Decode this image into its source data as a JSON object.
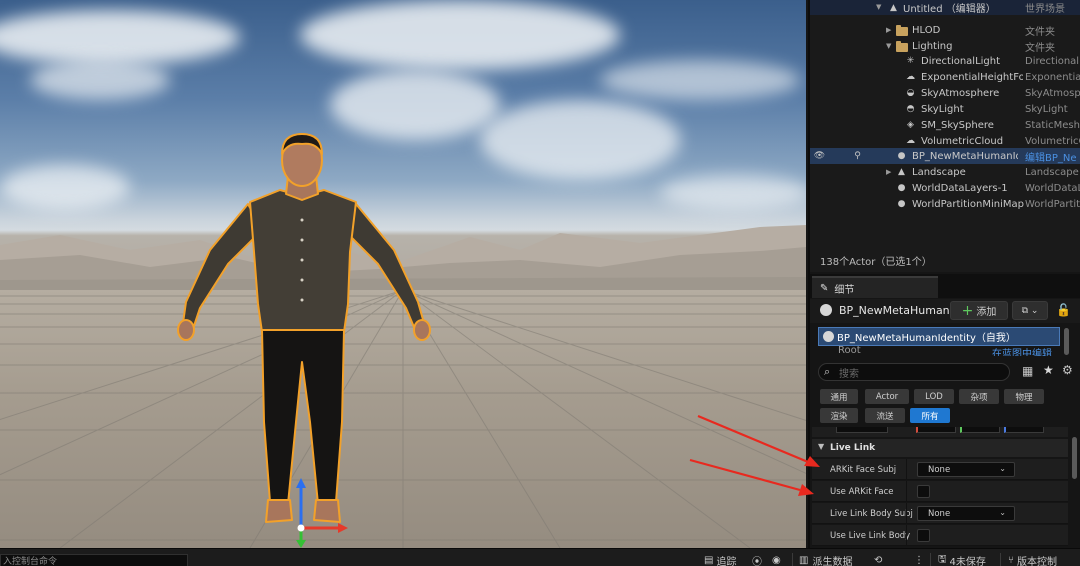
{
  "outliner": {
    "rows": [
      {
        "name": "Untitled （编辑器）",
        "type": "世界场景",
        "icon": "level-icon"
      },
      {
        "name": "HLOD",
        "type": "文件夹",
        "icon": "folder-icon"
      },
      {
        "name": "Lighting",
        "type": "文件夹",
        "icon": "folder-open-icon"
      },
      {
        "name": "DirectionalLight",
        "type": "DirectionalL",
        "icon": "directional-light-icon"
      },
      {
        "name": "ExponentialHeightFo",
        "type": "Exponential",
        "icon": "height-fog-icon"
      },
      {
        "name": "SkyAtmosphere",
        "type": "SkyAtmosp",
        "icon": "sky-atmosphere-icon"
      },
      {
        "name": "SkyLight",
        "type": "SkyLight",
        "icon": "sky-light-icon"
      },
      {
        "name": "SM_SkySphere",
        "type": "StaticMesh.",
        "icon": "static-mesh-icon"
      },
      {
        "name": "VolumetricCloud",
        "type": "VolumetricC",
        "icon": "cloud-icon"
      },
      {
        "name": "BP_NewMetaHumanId",
        "type": "编辑BP_Ne",
        "icon": "blueprint-icon"
      },
      {
        "name": "Landscape",
        "type": "Landscape",
        "icon": "landscape-icon"
      },
      {
        "name": "WorldDataLayers-1",
        "type": "WorldDataL",
        "icon": "actor-icon"
      },
      {
        "name": "WorldPartitionMiniMap",
        "type": "WorldPartit",
        "icon": "actor-icon"
      }
    ],
    "actor_count": "138个Actor（已选1个）"
  },
  "details": {
    "tab_label": "细节",
    "actor_name": "BP_NewMetaHuman",
    "add_button": "添加",
    "component_root": "BP_NewMetaHumanIdentity（自我）",
    "component_partial": "Root",
    "component_partial_right": "在蓝图中编辑",
    "search_placeholder": "搜索",
    "filters_row1": [
      "通用",
      "Actor",
      "LOD",
      "杂项",
      "物理"
    ],
    "filters_row2": [
      "渲染",
      "流送",
      "所有"
    ],
    "active_filter": "所有",
    "section_title": "Live Link",
    "properties": [
      {
        "label": "ARKit Face Subj",
        "kind": "combo",
        "value": "None"
      },
      {
        "label": "Use ARKit Face",
        "kind": "check",
        "value": ""
      },
      {
        "label": "Live Link Body Subj",
        "kind": "combo",
        "value": "None"
      },
      {
        "label": "Use Live Link Body",
        "kind": "check",
        "value": ""
      }
    ]
  },
  "statusbar": {
    "command_placeholder": "入控制台命令",
    "trace": "追踪",
    "derived_data": "派生数据",
    "unsaved": "4未保存",
    "source_control": "版本控制"
  },
  "colors": {
    "selection": "#253a5a",
    "accent_blue": "#1f78d1",
    "annotation_red": "#e8291f",
    "gizmo_x": "#e53a2a",
    "gizmo_y": "#34c034",
    "gizmo_z": "#2a6ff0",
    "character_outline": "#f2a12a"
  }
}
